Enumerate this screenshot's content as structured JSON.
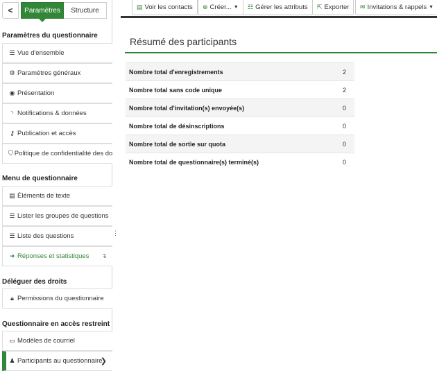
{
  "sidebar": {
    "collapse_glyph": "<",
    "tabs": [
      {
        "label": "Paramètres",
        "active": true
      },
      {
        "label": "Structure",
        "active": false
      }
    ],
    "sections": [
      {
        "title": "Paramètres du questionnaire"
      },
      {
        "title": "Menu de questionnaire"
      },
      {
        "title": "Déléguer des droits"
      },
      {
        "title": "Questionnaire en accès restreint"
      }
    ],
    "items": [
      {
        "label": "Vue d'ensemble",
        "icon": "list-icon"
      },
      {
        "label": "Paramètres généraux",
        "icon": "cogs-icon"
      },
      {
        "label": "Présentation",
        "icon": "eye-icon"
      },
      {
        "label": "Notifications & données",
        "icon": "rss-icon"
      },
      {
        "label": "Publication et accès",
        "icon": "key-icon"
      },
      {
        "label": "Politique de confidentialité des donn",
        "icon": "shield-icon"
      },
      {
        "label": "Éléments de texte",
        "icon": "file-text-icon"
      },
      {
        "label": "Lister les groupes de questions",
        "icon": "list-icon"
      },
      {
        "label": "Liste des questions",
        "icon": "list-icon"
      },
      {
        "label": "Réponses et statistiques",
        "icon": "arrow-right-icon"
      },
      {
        "label": "Permissions du questionnaire",
        "icon": "lock-icon"
      },
      {
        "label": "Modèles de courriel",
        "icon": "window-icon"
      },
      {
        "label": "Participants au questionnaire",
        "icon": "user-icon"
      }
    ]
  },
  "toolbar": {
    "buttons": [
      {
        "label": "Voir les contacts",
        "icon": "list-alt-icon"
      },
      {
        "label": "Créer...",
        "icon": "plus-circle-icon"
      },
      {
        "label": "Gérer les attributs",
        "icon": "tasks-icon"
      },
      {
        "label": "Exporter",
        "icon": "export-icon"
      },
      {
        "label": "Invitations & rappels",
        "icon": "envelope-icon"
      }
    ]
  },
  "main": {
    "title": "Résumé des participants",
    "rows": [
      {
        "label": "Nombre total d'enregistrements",
        "value": "2"
      },
      {
        "label": "Nombre total sans code unique",
        "value": "2"
      },
      {
        "label": "Nombre total d'invitation(s) envoyée(s)",
        "value": "0"
      },
      {
        "label": "Nombre total de désinscriptions",
        "value": "0"
      },
      {
        "label": "Nombre total de sortie sur quota",
        "value": "0"
      },
      {
        "label": "Nombre total de questionnaire(s) terminé(s)",
        "value": "0"
      }
    ]
  },
  "colors": {
    "accent": "#328637"
  }
}
